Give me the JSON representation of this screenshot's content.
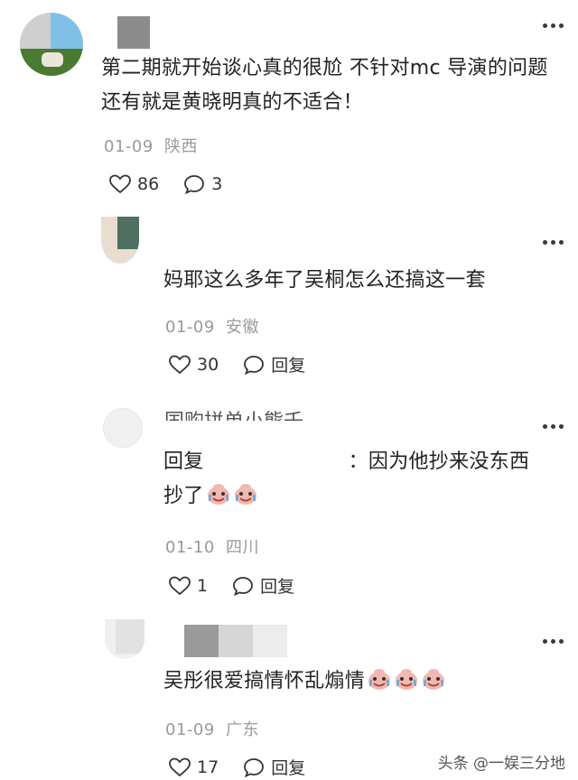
{
  "comments": [
    {
      "text": "第二期就开始谈心真的很尬 不针对mc 导演的问题 还有就是黄晓明真的不适合！",
      "date": "01-09",
      "region": "陕西",
      "likes": "86",
      "replies": "3"
    },
    {
      "text": "妈耶这么多年了吴桐怎么还搞这一套",
      "date": "01-09",
      "region": "安徽",
      "likes": "30",
      "reply_label": "回复"
    },
    {
      "partial_name": "国购拼单小熊壬",
      "reply_prefix": "回复",
      "text": "：因为他抄来没东西",
      "text2": "抄了",
      "date": "01-10",
      "region": "四川",
      "likes": "1",
      "reply_label": "回复"
    },
    {
      "text": "吴彤很爱搞情怀乱煽情",
      "date": "01-09",
      "region": "广东",
      "likes": "17",
      "reply_label": "回复"
    }
  ],
  "watermark": "头条 @一娱三分地",
  "icons": {
    "like": "heart-outline-icon",
    "reply": "speech-bubble-icon",
    "more": "more-dots-icon",
    "emoji": "crying-face-emoji"
  }
}
